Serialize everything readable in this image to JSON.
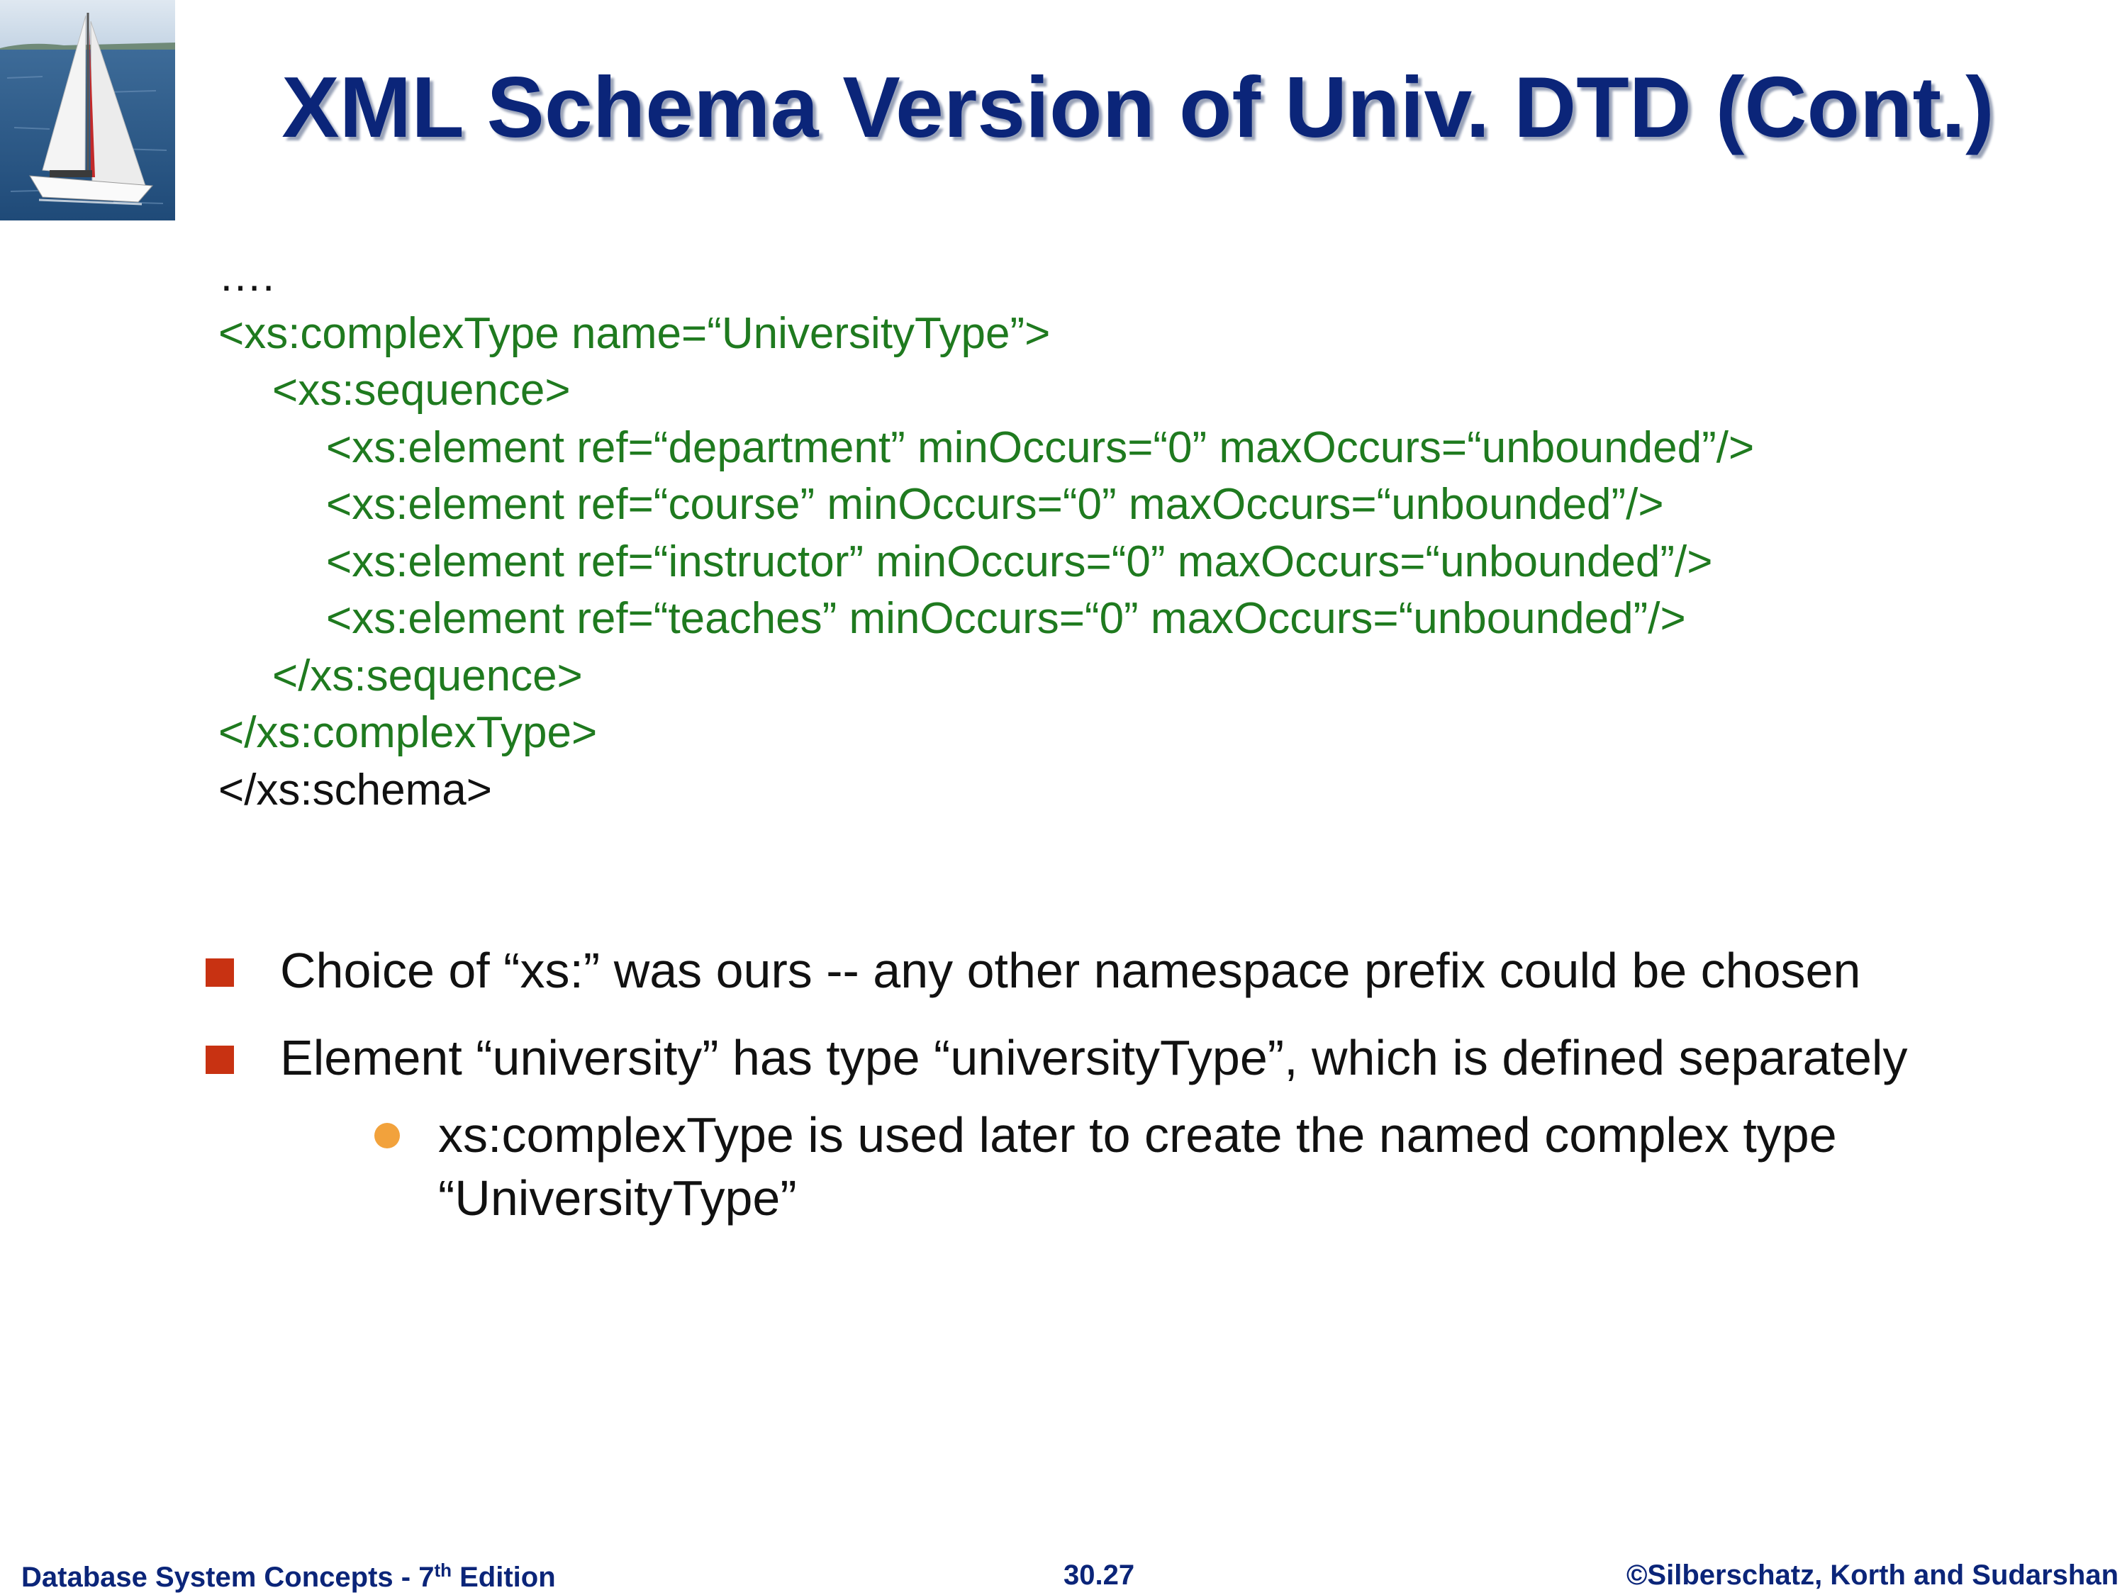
{
  "title": "XML Schema Version of Univ. DTD (Cont.)",
  "code": [
    {
      "text": "….",
      "indent": 0,
      "color": "black"
    },
    {
      "text": "<xs:complexType name=“UniversityType”>",
      "indent": 0,
      "color": "green"
    },
    {
      "text": "<xs:sequence>",
      "indent": 1,
      "color": "green"
    },
    {
      "text": "<xs:element ref=“department” minOccurs=“0” maxOccurs=“unbounded”/>",
      "indent": 2,
      "color": "green"
    },
    {
      "text": "<xs:element ref=“course” minOccurs=“0” maxOccurs=“unbounded”/>",
      "indent": 2,
      "color": "green"
    },
    {
      "text": "<xs:element ref=“instructor” minOccurs=“0” maxOccurs=“unbounded”/>",
      "indent": 2,
      "color": "green"
    },
    {
      "text": "<xs:element ref=“teaches” minOccurs=“0” maxOccurs=“unbounded”/>",
      "indent": 2,
      "color": "green"
    },
    {
      "text": "</xs:sequence>",
      "indent": 1,
      "color": "green"
    },
    {
      "text": "</xs:complexType>",
      "indent": 0,
      "color": "green"
    },
    {
      "text": "</xs:schema>",
      "indent": 0,
      "color": "black"
    }
  ],
  "bullets": [
    {
      "text": "Choice of “xs:” was ours -- any other namespace prefix could be chosen"
    },
    {
      "text": "Element “university” has type “universityType”, which is defined separately"
    }
  ],
  "subbullets": [
    {
      "text": "xs:complexType is used later to create the named complex type “UniversityType”"
    }
  ],
  "footer": {
    "left_prefix": "Database System Concepts - 7",
    "left_sup": "th",
    "left_suffix": " Edition",
    "center": "30.27",
    "right": "©Silberschatz, Korth and Sudarshan"
  },
  "colors": {
    "title": "#0b2579",
    "code_green": "#1f7a1f",
    "bullet_square": "#c83212",
    "sub_bullet_dot": "#f2a23c",
    "footer": "#0b2579"
  }
}
